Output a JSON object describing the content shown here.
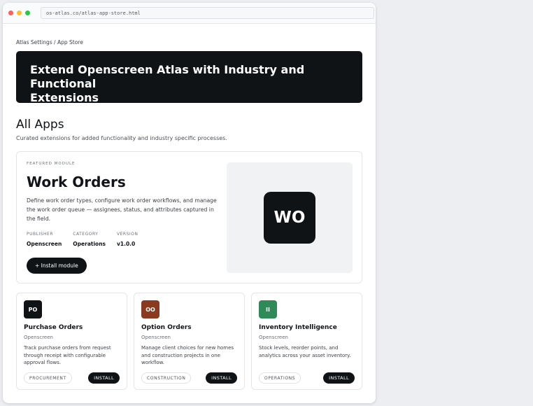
{
  "browser": {
    "url": "os-atlas.co/atlas-app-store.html",
    "dot_colors": [
      "#ff5f57",
      "#febc2e",
      "#28c840"
    ]
  },
  "breadcrumb": "Atlas Settings / App Store",
  "hero": {
    "title_line1": "Extend Openscreen Atlas with Industry and Functional",
    "title_line2": "Extensions"
  },
  "section": {
    "title": "All Apps",
    "subtitle": "Curated extensions for added functionality and industry specific processes."
  },
  "featured": {
    "label": "FEATURED MODULE",
    "title": "Work Orders",
    "description": "Define work order types, configure work order workflows, and manage the work order queue — assignees, status, and attributes captured in the field.",
    "meta": [
      {
        "label": "PUBLISHER",
        "value": "Openscreen"
      },
      {
        "label": "CATEGORY",
        "value": "Operations"
      },
      {
        "label": "VERSION",
        "value": "v1.0.0"
      }
    ],
    "install_label": "+ Install module",
    "logo_text": "WO"
  },
  "cards": [
    {
      "icon_text": "PO",
      "icon_color": "#0f1316",
      "title": "Purchase Orders",
      "publisher": "Openscreen",
      "description": "Track purchase orders from request through receipt with configurable approval flows.",
      "tag": "PROCUREMENT",
      "install_label": "INSTALL"
    },
    {
      "icon_text": "OO",
      "icon_color": "#8b3a1f",
      "title": "Option Orders",
      "publisher": "Openscreen",
      "description": "Manage client choices for new homes and construction projects in one workflow.",
      "tag": "CONSTRUCTION",
      "install_label": "INSTALL"
    },
    {
      "icon_text": "II",
      "icon_color": "#2e8b57",
      "title": "Inventory Intelligence",
      "publisher": "Openscreen",
      "description": "Stock levels, reorder points, and analytics across your asset inventory.",
      "tag": "OPERATIONS",
      "install_label": "INSTALL"
    }
  ]
}
